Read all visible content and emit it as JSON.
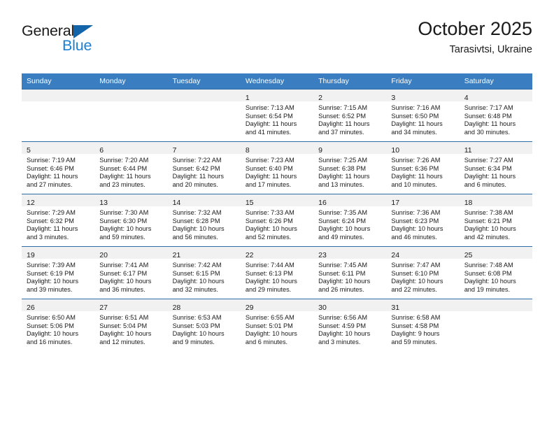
{
  "brand": {
    "word_one": "General",
    "word_two": "Blue",
    "triangle_color": "#1464aa",
    "blue_text_color": "#1b7fd4"
  },
  "header": {
    "title": "October 2025",
    "subtitle": "Tarasivtsi, Ukraine"
  },
  "colors": {
    "header_row": "#3a7ec1",
    "daynum_band": "#f1f1f1",
    "cell_border": "#2d6ca8"
  },
  "weekday_headers": [
    "Sunday",
    "Monday",
    "Tuesday",
    "Wednesday",
    "Thursday",
    "Friday",
    "Saturday"
  ],
  "labels": {
    "sunrise": "Sunrise:",
    "sunset": "Sunset:",
    "daylight": "Daylight:"
  },
  "weeks": [
    [
      {
        "day": "",
        "lines": []
      },
      {
        "day": "",
        "lines": []
      },
      {
        "day": "",
        "lines": []
      },
      {
        "day": "1",
        "lines": [
          "Sunrise: 7:13 AM",
          "Sunset: 6:54 PM",
          "Daylight: 11 hours",
          "and 41 minutes."
        ]
      },
      {
        "day": "2",
        "lines": [
          "Sunrise: 7:15 AM",
          "Sunset: 6:52 PM",
          "Daylight: 11 hours",
          "and 37 minutes."
        ]
      },
      {
        "day": "3",
        "lines": [
          "Sunrise: 7:16 AM",
          "Sunset: 6:50 PM",
          "Daylight: 11 hours",
          "and 34 minutes."
        ]
      },
      {
        "day": "4",
        "lines": [
          "Sunrise: 7:17 AM",
          "Sunset: 6:48 PM",
          "Daylight: 11 hours",
          "and 30 minutes."
        ]
      }
    ],
    [
      {
        "day": "5",
        "lines": [
          "Sunrise: 7:19 AM",
          "Sunset: 6:46 PM",
          "Daylight: 11 hours",
          "and 27 minutes."
        ]
      },
      {
        "day": "6",
        "lines": [
          "Sunrise: 7:20 AM",
          "Sunset: 6:44 PM",
          "Daylight: 11 hours",
          "and 23 minutes."
        ]
      },
      {
        "day": "7",
        "lines": [
          "Sunrise: 7:22 AM",
          "Sunset: 6:42 PM",
          "Daylight: 11 hours",
          "and 20 minutes."
        ]
      },
      {
        "day": "8",
        "lines": [
          "Sunrise: 7:23 AM",
          "Sunset: 6:40 PM",
          "Daylight: 11 hours",
          "and 17 minutes."
        ]
      },
      {
        "day": "9",
        "lines": [
          "Sunrise: 7:25 AM",
          "Sunset: 6:38 PM",
          "Daylight: 11 hours",
          "and 13 minutes."
        ]
      },
      {
        "day": "10",
        "lines": [
          "Sunrise: 7:26 AM",
          "Sunset: 6:36 PM",
          "Daylight: 11 hours",
          "and 10 minutes."
        ]
      },
      {
        "day": "11",
        "lines": [
          "Sunrise: 7:27 AM",
          "Sunset: 6:34 PM",
          "Daylight: 11 hours",
          "and 6 minutes."
        ]
      }
    ],
    [
      {
        "day": "12",
        "lines": [
          "Sunrise: 7:29 AM",
          "Sunset: 6:32 PM",
          "Daylight: 11 hours",
          "and 3 minutes."
        ]
      },
      {
        "day": "13",
        "lines": [
          "Sunrise: 7:30 AM",
          "Sunset: 6:30 PM",
          "Daylight: 10 hours",
          "and 59 minutes."
        ]
      },
      {
        "day": "14",
        "lines": [
          "Sunrise: 7:32 AM",
          "Sunset: 6:28 PM",
          "Daylight: 10 hours",
          "and 56 minutes."
        ]
      },
      {
        "day": "15",
        "lines": [
          "Sunrise: 7:33 AM",
          "Sunset: 6:26 PM",
          "Daylight: 10 hours",
          "and 52 minutes."
        ]
      },
      {
        "day": "16",
        "lines": [
          "Sunrise: 7:35 AM",
          "Sunset: 6:24 PM",
          "Daylight: 10 hours",
          "and 49 minutes."
        ]
      },
      {
        "day": "17",
        "lines": [
          "Sunrise: 7:36 AM",
          "Sunset: 6:23 PM",
          "Daylight: 10 hours",
          "and 46 minutes."
        ]
      },
      {
        "day": "18",
        "lines": [
          "Sunrise: 7:38 AM",
          "Sunset: 6:21 PM",
          "Daylight: 10 hours",
          "and 42 minutes."
        ]
      }
    ],
    [
      {
        "day": "19",
        "lines": [
          "Sunrise: 7:39 AM",
          "Sunset: 6:19 PM",
          "Daylight: 10 hours",
          "and 39 minutes."
        ]
      },
      {
        "day": "20",
        "lines": [
          "Sunrise: 7:41 AM",
          "Sunset: 6:17 PM",
          "Daylight: 10 hours",
          "and 36 minutes."
        ]
      },
      {
        "day": "21",
        "lines": [
          "Sunrise: 7:42 AM",
          "Sunset: 6:15 PM",
          "Daylight: 10 hours",
          "and 32 minutes."
        ]
      },
      {
        "day": "22",
        "lines": [
          "Sunrise: 7:44 AM",
          "Sunset: 6:13 PM",
          "Daylight: 10 hours",
          "and 29 minutes."
        ]
      },
      {
        "day": "23",
        "lines": [
          "Sunrise: 7:45 AM",
          "Sunset: 6:11 PM",
          "Daylight: 10 hours",
          "and 26 minutes."
        ]
      },
      {
        "day": "24",
        "lines": [
          "Sunrise: 7:47 AM",
          "Sunset: 6:10 PM",
          "Daylight: 10 hours",
          "and 22 minutes."
        ]
      },
      {
        "day": "25",
        "lines": [
          "Sunrise: 7:48 AM",
          "Sunset: 6:08 PM",
          "Daylight: 10 hours",
          "and 19 minutes."
        ]
      }
    ],
    [
      {
        "day": "26",
        "lines": [
          "Sunrise: 6:50 AM",
          "Sunset: 5:06 PM",
          "Daylight: 10 hours",
          "and 16 minutes."
        ]
      },
      {
        "day": "27",
        "lines": [
          "Sunrise: 6:51 AM",
          "Sunset: 5:04 PM",
          "Daylight: 10 hours",
          "and 12 minutes."
        ]
      },
      {
        "day": "28",
        "lines": [
          "Sunrise: 6:53 AM",
          "Sunset: 5:03 PM",
          "Daylight: 10 hours",
          "and 9 minutes."
        ]
      },
      {
        "day": "29",
        "lines": [
          "Sunrise: 6:55 AM",
          "Sunset: 5:01 PM",
          "Daylight: 10 hours",
          "and 6 minutes."
        ]
      },
      {
        "day": "30",
        "lines": [
          "Sunrise: 6:56 AM",
          "Sunset: 4:59 PM",
          "Daylight: 10 hours",
          "and 3 minutes."
        ]
      },
      {
        "day": "31",
        "lines": [
          "Sunrise: 6:58 AM",
          "Sunset: 4:58 PM",
          "Daylight: 9 hours",
          "and 59 minutes."
        ]
      },
      {
        "day": "",
        "lines": []
      }
    ]
  ]
}
